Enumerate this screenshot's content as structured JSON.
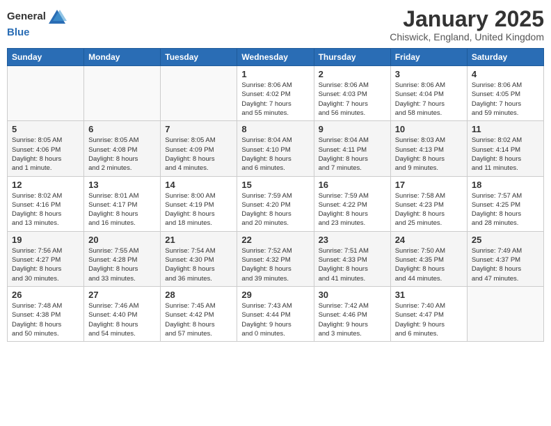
{
  "header": {
    "logo_general": "General",
    "logo_blue": "Blue",
    "month_title": "January 2025",
    "subtitle": "Chiswick, England, United Kingdom"
  },
  "calendar": {
    "days_of_week": [
      "Sunday",
      "Monday",
      "Tuesday",
      "Wednesday",
      "Thursday",
      "Friday",
      "Saturday"
    ],
    "weeks": [
      [
        {
          "day": "",
          "info": ""
        },
        {
          "day": "",
          "info": ""
        },
        {
          "day": "",
          "info": ""
        },
        {
          "day": "1",
          "info": "Sunrise: 8:06 AM\nSunset: 4:02 PM\nDaylight: 7 hours\nand 55 minutes."
        },
        {
          "day": "2",
          "info": "Sunrise: 8:06 AM\nSunset: 4:03 PM\nDaylight: 7 hours\nand 56 minutes."
        },
        {
          "day": "3",
          "info": "Sunrise: 8:06 AM\nSunset: 4:04 PM\nDaylight: 7 hours\nand 58 minutes."
        },
        {
          "day": "4",
          "info": "Sunrise: 8:06 AM\nSunset: 4:05 PM\nDaylight: 7 hours\nand 59 minutes."
        }
      ],
      [
        {
          "day": "5",
          "info": "Sunrise: 8:05 AM\nSunset: 4:06 PM\nDaylight: 8 hours\nand 1 minute."
        },
        {
          "day": "6",
          "info": "Sunrise: 8:05 AM\nSunset: 4:08 PM\nDaylight: 8 hours\nand 2 minutes."
        },
        {
          "day": "7",
          "info": "Sunrise: 8:05 AM\nSunset: 4:09 PM\nDaylight: 8 hours\nand 4 minutes."
        },
        {
          "day": "8",
          "info": "Sunrise: 8:04 AM\nSunset: 4:10 PM\nDaylight: 8 hours\nand 6 minutes."
        },
        {
          "day": "9",
          "info": "Sunrise: 8:04 AM\nSunset: 4:11 PM\nDaylight: 8 hours\nand 7 minutes."
        },
        {
          "day": "10",
          "info": "Sunrise: 8:03 AM\nSunset: 4:13 PM\nDaylight: 8 hours\nand 9 minutes."
        },
        {
          "day": "11",
          "info": "Sunrise: 8:02 AM\nSunset: 4:14 PM\nDaylight: 8 hours\nand 11 minutes."
        }
      ],
      [
        {
          "day": "12",
          "info": "Sunrise: 8:02 AM\nSunset: 4:16 PM\nDaylight: 8 hours\nand 13 minutes."
        },
        {
          "day": "13",
          "info": "Sunrise: 8:01 AM\nSunset: 4:17 PM\nDaylight: 8 hours\nand 16 minutes."
        },
        {
          "day": "14",
          "info": "Sunrise: 8:00 AM\nSunset: 4:19 PM\nDaylight: 8 hours\nand 18 minutes."
        },
        {
          "day": "15",
          "info": "Sunrise: 7:59 AM\nSunset: 4:20 PM\nDaylight: 8 hours\nand 20 minutes."
        },
        {
          "day": "16",
          "info": "Sunrise: 7:59 AM\nSunset: 4:22 PM\nDaylight: 8 hours\nand 23 minutes."
        },
        {
          "day": "17",
          "info": "Sunrise: 7:58 AM\nSunset: 4:23 PM\nDaylight: 8 hours\nand 25 minutes."
        },
        {
          "day": "18",
          "info": "Sunrise: 7:57 AM\nSunset: 4:25 PM\nDaylight: 8 hours\nand 28 minutes."
        }
      ],
      [
        {
          "day": "19",
          "info": "Sunrise: 7:56 AM\nSunset: 4:27 PM\nDaylight: 8 hours\nand 30 minutes."
        },
        {
          "day": "20",
          "info": "Sunrise: 7:55 AM\nSunset: 4:28 PM\nDaylight: 8 hours\nand 33 minutes."
        },
        {
          "day": "21",
          "info": "Sunrise: 7:54 AM\nSunset: 4:30 PM\nDaylight: 8 hours\nand 36 minutes."
        },
        {
          "day": "22",
          "info": "Sunrise: 7:52 AM\nSunset: 4:32 PM\nDaylight: 8 hours\nand 39 minutes."
        },
        {
          "day": "23",
          "info": "Sunrise: 7:51 AM\nSunset: 4:33 PM\nDaylight: 8 hours\nand 41 minutes."
        },
        {
          "day": "24",
          "info": "Sunrise: 7:50 AM\nSunset: 4:35 PM\nDaylight: 8 hours\nand 44 minutes."
        },
        {
          "day": "25",
          "info": "Sunrise: 7:49 AM\nSunset: 4:37 PM\nDaylight: 8 hours\nand 47 minutes."
        }
      ],
      [
        {
          "day": "26",
          "info": "Sunrise: 7:48 AM\nSunset: 4:38 PM\nDaylight: 8 hours\nand 50 minutes."
        },
        {
          "day": "27",
          "info": "Sunrise: 7:46 AM\nSunset: 4:40 PM\nDaylight: 8 hours\nand 54 minutes."
        },
        {
          "day": "28",
          "info": "Sunrise: 7:45 AM\nSunset: 4:42 PM\nDaylight: 8 hours\nand 57 minutes."
        },
        {
          "day": "29",
          "info": "Sunrise: 7:43 AM\nSunset: 4:44 PM\nDaylight: 9 hours\nand 0 minutes."
        },
        {
          "day": "30",
          "info": "Sunrise: 7:42 AM\nSunset: 4:46 PM\nDaylight: 9 hours\nand 3 minutes."
        },
        {
          "day": "31",
          "info": "Sunrise: 7:40 AM\nSunset: 4:47 PM\nDaylight: 9 hours\nand 6 minutes."
        },
        {
          "day": "",
          "info": ""
        }
      ]
    ]
  }
}
